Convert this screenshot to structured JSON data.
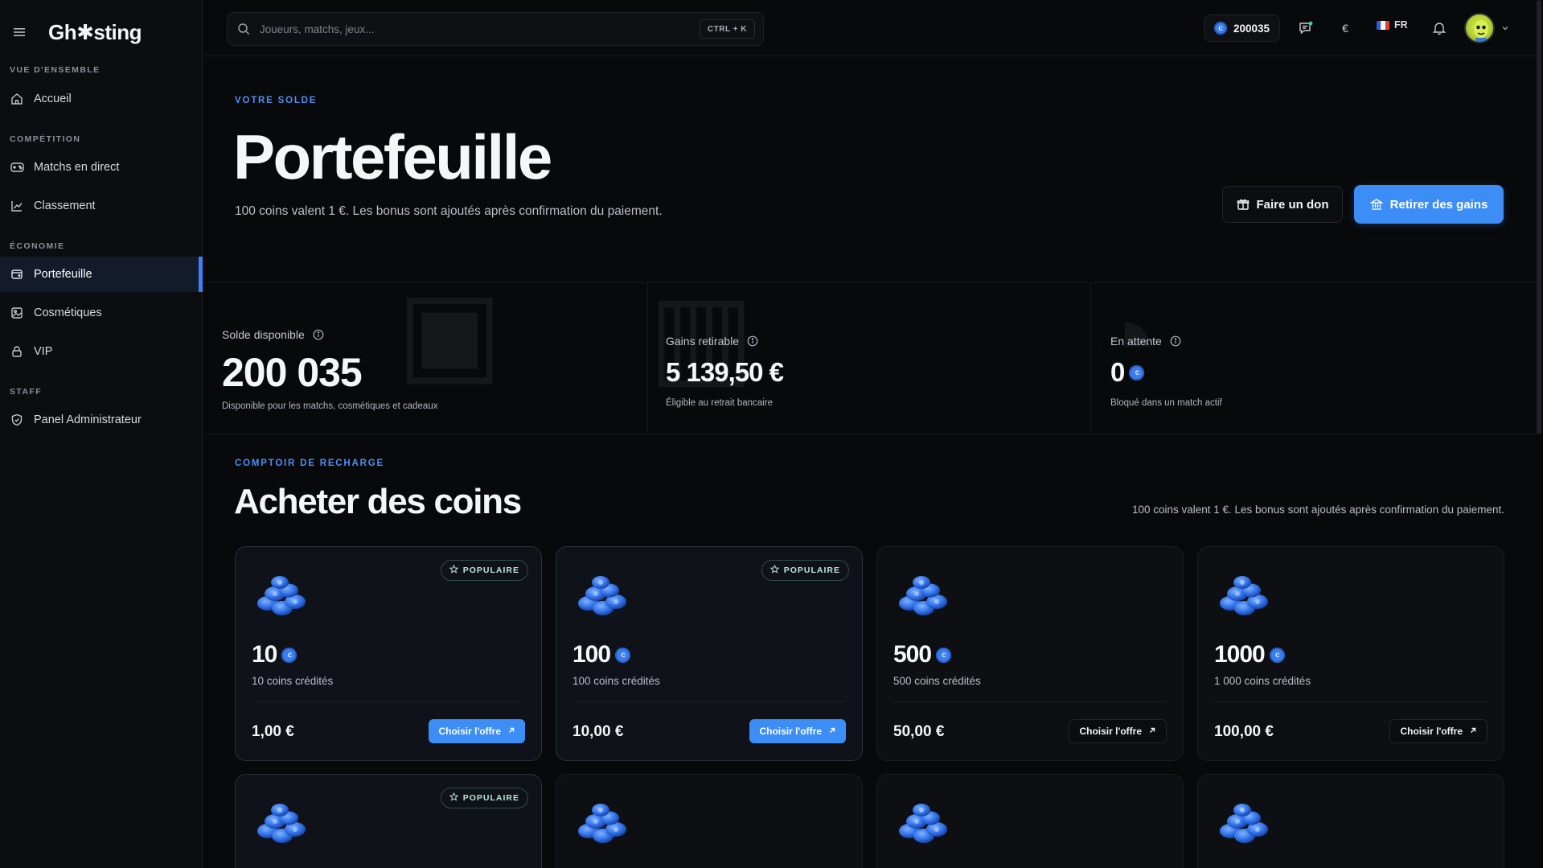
{
  "app": {
    "name": "Gh✱sting"
  },
  "sidebar": {
    "sections": [
      {
        "title": "VUE D'ENSEMBLE",
        "items": [
          {
            "label": "Accueil",
            "icon": "home-icon"
          }
        ]
      },
      {
        "title": "COMPÉTITION",
        "items": [
          {
            "label": "Matchs en direct",
            "icon": "gamepad-icon"
          },
          {
            "label": "Classement",
            "icon": "chart-icon"
          }
        ]
      },
      {
        "title": "ÉCONOMIE",
        "items": [
          {
            "label": "Portefeuille",
            "icon": "wallet-icon",
            "active": true
          },
          {
            "label": "Cosmétiques",
            "icon": "image-icon"
          },
          {
            "label": "VIP",
            "icon": "lock-icon"
          }
        ]
      },
      {
        "title": "STAFF",
        "items": [
          {
            "label": "Panel Administrateur",
            "icon": "shield-icon"
          }
        ]
      }
    ]
  },
  "topbar": {
    "search_placeholder": "Joueurs, matchs, jeux...",
    "shortcut": "CTRL + K",
    "balance": "200035",
    "currency_symbol": "€",
    "language": "FR"
  },
  "hero": {
    "eyebrow": "VOTRE SOLDE",
    "title": "Portefeuille",
    "subtitle": "100 coins valent 1 €. Les bonus sont ajoutés après confirmation du paiement.",
    "donate_label": "Faire un don",
    "withdraw_label": "Retirer des gains"
  },
  "stats": [
    {
      "label": "Solde disponible",
      "value": "200 035",
      "desc": "Disponible pour les matchs, cosmétiques et cadeaux"
    },
    {
      "label": "Gains retirable",
      "value": "5 139,50 €",
      "desc": "Éligible au retrait bancaire"
    },
    {
      "label": "En attente",
      "value": "0",
      "desc": "Bloqué dans un match actif"
    }
  ],
  "shop": {
    "eyebrow": "COMPTOIR DE RECHARGE",
    "title": "Acheter des coins",
    "note": "100 coins valent 1 €. Les bonus sont ajoutés après confirmation du paiement.",
    "popular_label": "POPULAIRE",
    "choose_label": "Choisir l'offre",
    "offers": [
      {
        "amount": "10",
        "credited": "10 coins crédités",
        "price": "1,00 €",
        "popular": true
      },
      {
        "amount": "100",
        "credited": "100 coins crédités",
        "price": "10,00 €",
        "popular": true
      },
      {
        "amount": "500",
        "credited": "500 coins crédités",
        "price": "50,00 €",
        "popular": false
      },
      {
        "amount": "1000",
        "credited": "1 000 coins crédités",
        "price": "100,00 €",
        "popular": false
      }
    ]
  },
  "colors": {
    "accent": "#3d8df6",
    "background": "#08090b",
    "sidebar": "#0c0d10",
    "active_nav": "#131a2a"
  }
}
